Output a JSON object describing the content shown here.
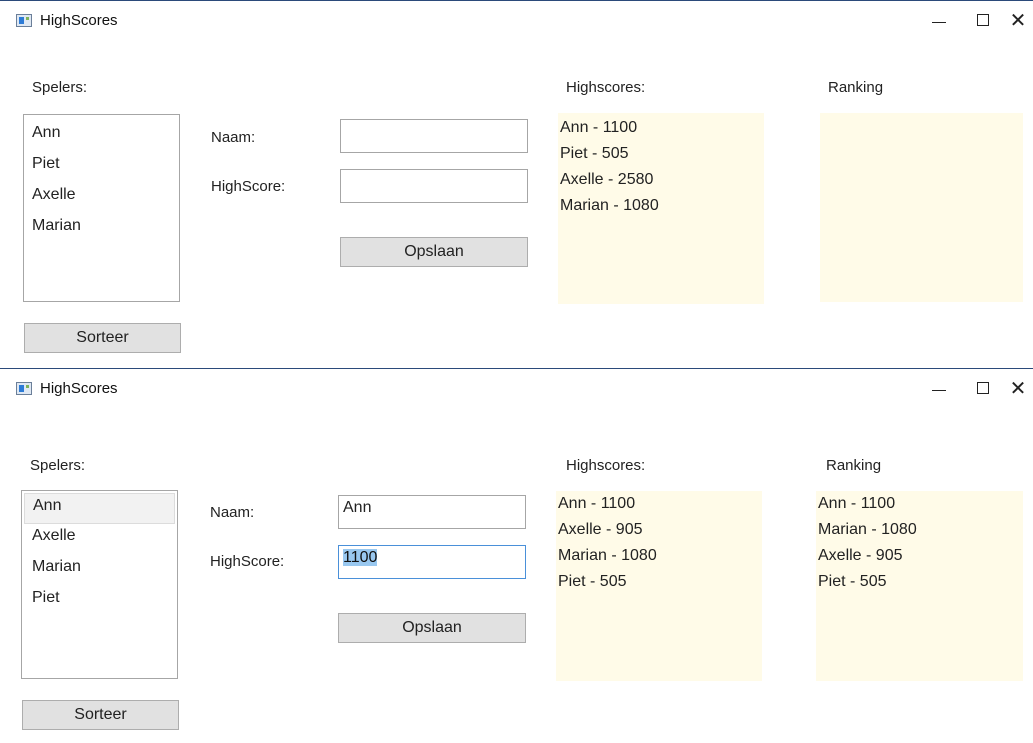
{
  "windows": [
    {
      "title": "HighScores",
      "labels": {
        "players": "Spelers:",
        "name": "Naam:",
        "highscore": "HighScore:",
        "highscores": "Highscores:",
        "ranking": "Ranking"
      },
      "players": [
        "Ann",
        "Piet",
        "Axelle",
        "Marian"
      ],
      "name_value": "",
      "highscore_value": "",
      "save_label": "Opslaan",
      "sort_label": "Sorteer",
      "highscores": [
        "Ann - 1100",
        "Piet - 505",
        "Axelle - 2580",
        "Marian - 1080"
      ],
      "ranking": []
    },
    {
      "title": "HighScores",
      "labels": {
        "players": "Spelers:",
        "name": "Naam:",
        "highscore": "HighScore:",
        "highscores": "Highscores:",
        "ranking": "Ranking"
      },
      "players": [
        "Ann",
        "Axelle",
        "Marian",
        "Piet"
      ],
      "selected_player": "Ann",
      "name_value": "Ann",
      "highscore_value": "1100",
      "save_label": "Opslaan",
      "sort_label": "Sorteer",
      "highscores": [
        "Ann - 1100",
        "Axelle - 905",
        "Marian - 1080",
        "Piet - 505"
      ],
      "ranking": [
        "Ann - 1100",
        "Marian - 1080",
        "Axelle - 905",
        "Piet - 505"
      ]
    }
  ],
  "colors": {
    "panel_bg": "#fffbe8",
    "focus_border": "#4a90d9",
    "selection": "#99c8f0"
  }
}
